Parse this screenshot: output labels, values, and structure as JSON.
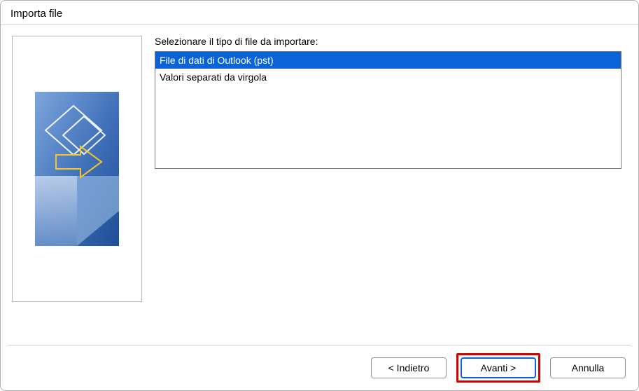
{
  "window": {
    "title": "Importa file"
  },
  "prompt": "Selezionare il tipo di file da importare:",
  "file_types": [
    {
      "label": "File di dati di Outlook (pst)",
      "selected": true
    },
    {
      "label": "Valori separati da virgola",
      "selected": false
    }
  ],
  "buttons": {
    "back": "< Indietro",
    "next": "Avanti >",
    "cancel": "Annulla"
  },
  "colors": {
    "selection": "#0a64d8",
    "callout": "#d40000"
  }
}
